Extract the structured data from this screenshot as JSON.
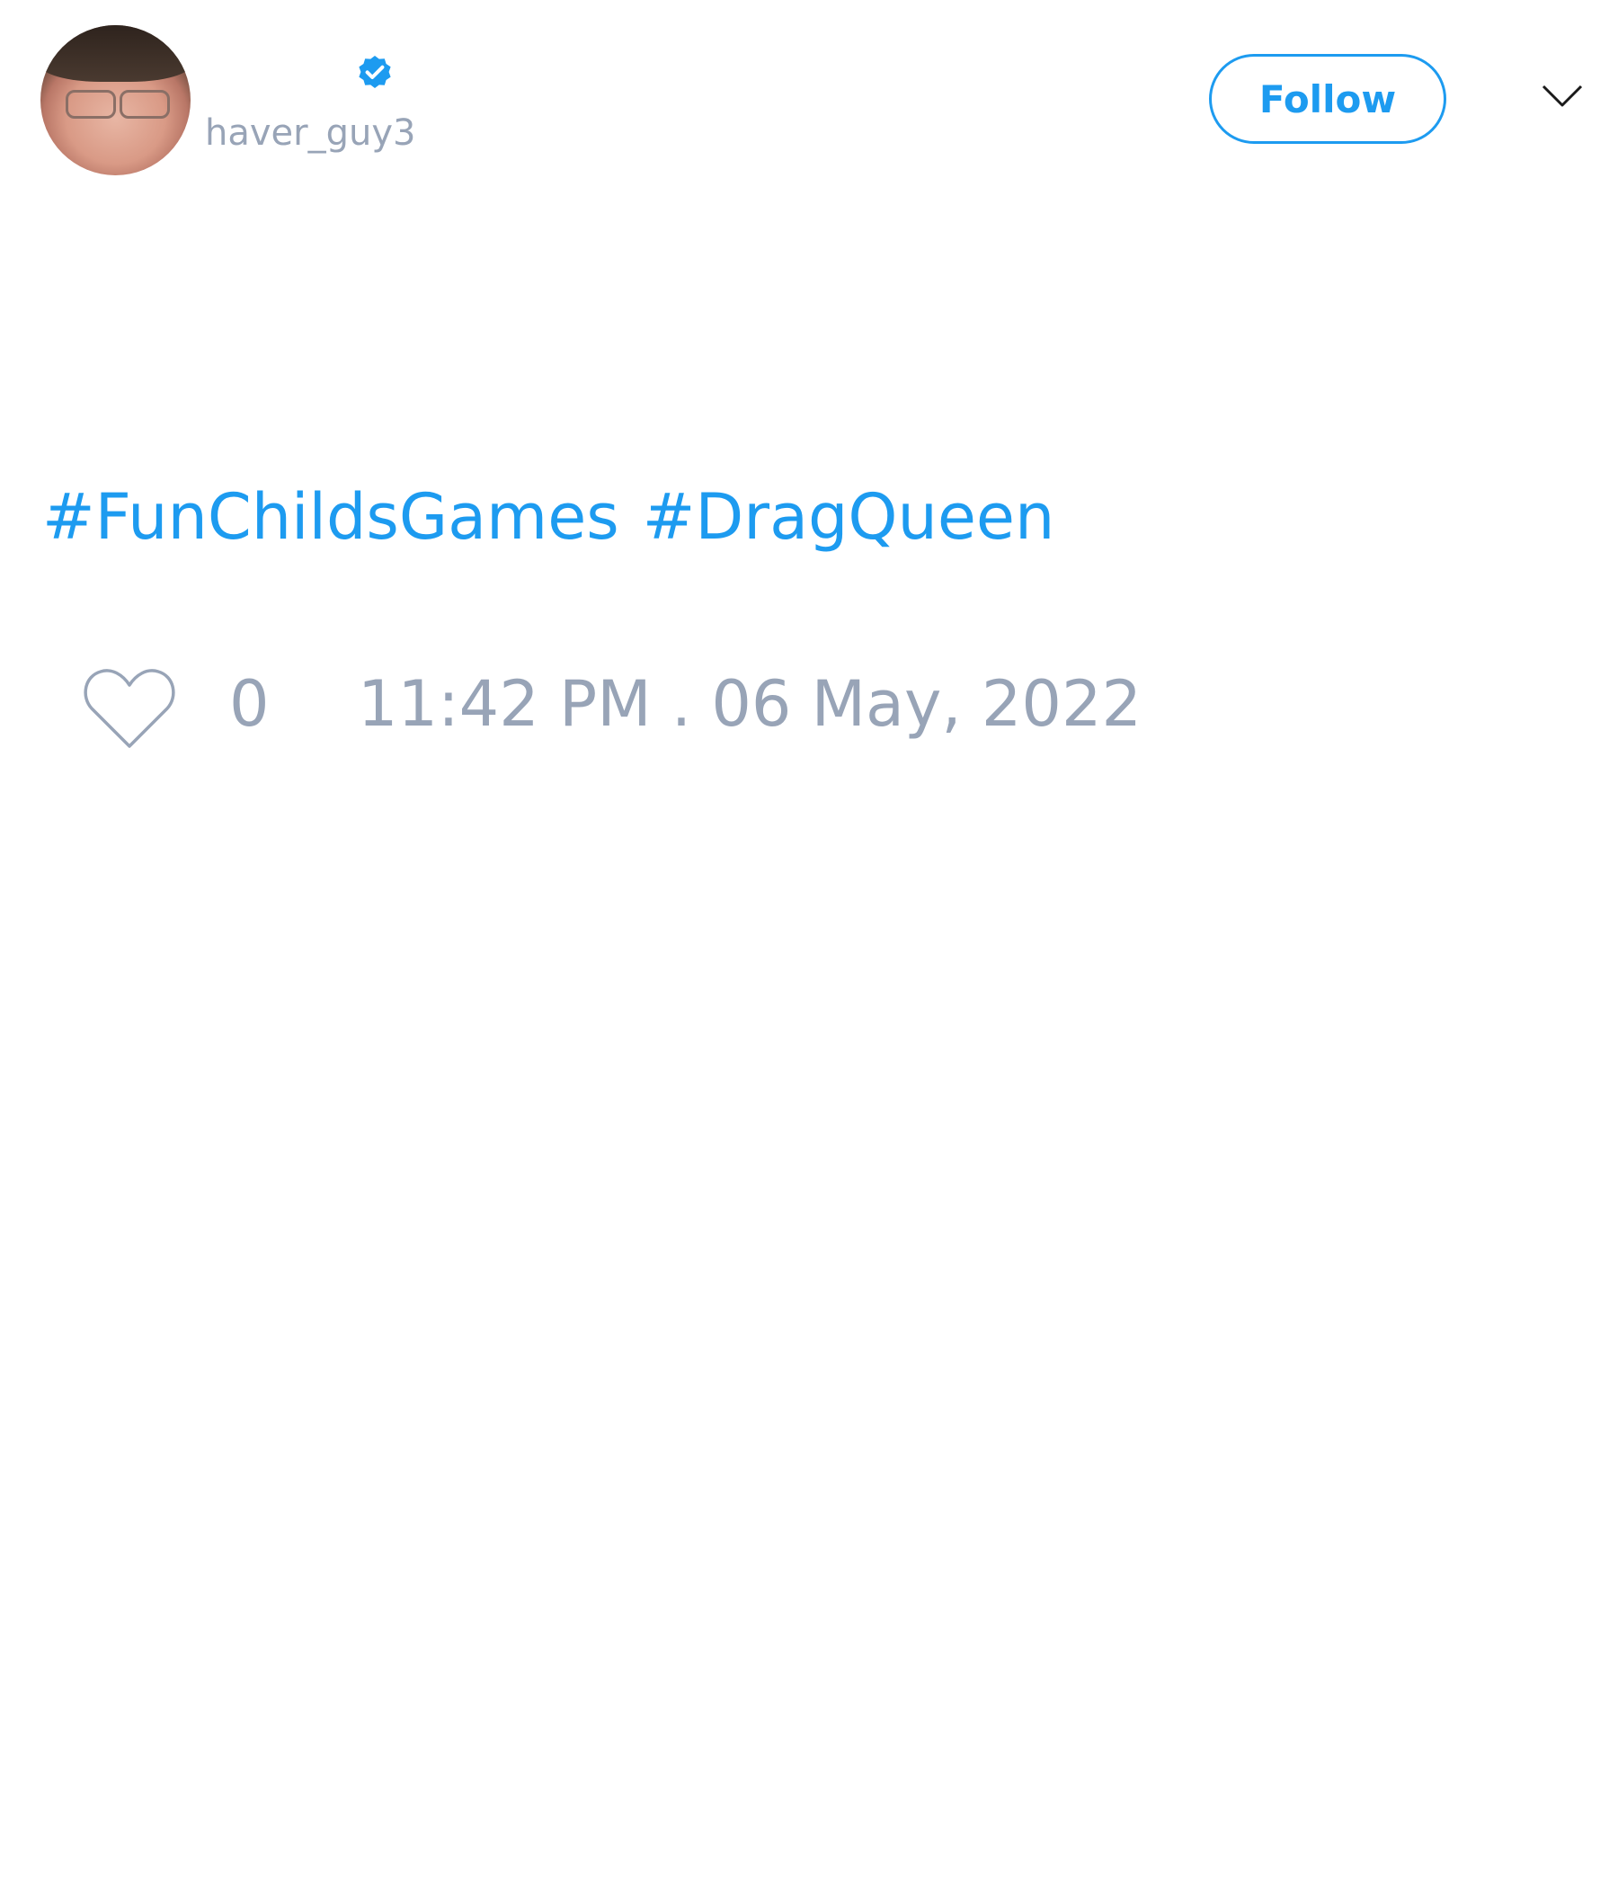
{
  "user": {
    "handle": "haver_guy3",
    "verified": true
  },
  "header": {
    "follow_label": "Follow"
  },
  "tweet": {
    "hashtags": [
      "#FunChildsGames",
      "#DragQueen"
    ],
    "like_count": "0",
    "timestamp": "11:42 PM . 06 May, 2022"
  },
  "icons": {
    "verified": "verified-badge-icon",
    "menu": "chevron-down-icon",
    "like": "heart-icon"
  },
  "colors": {
    "accent": "#1d9bf0",
    "muted": "#98a4b7"
  }
}
